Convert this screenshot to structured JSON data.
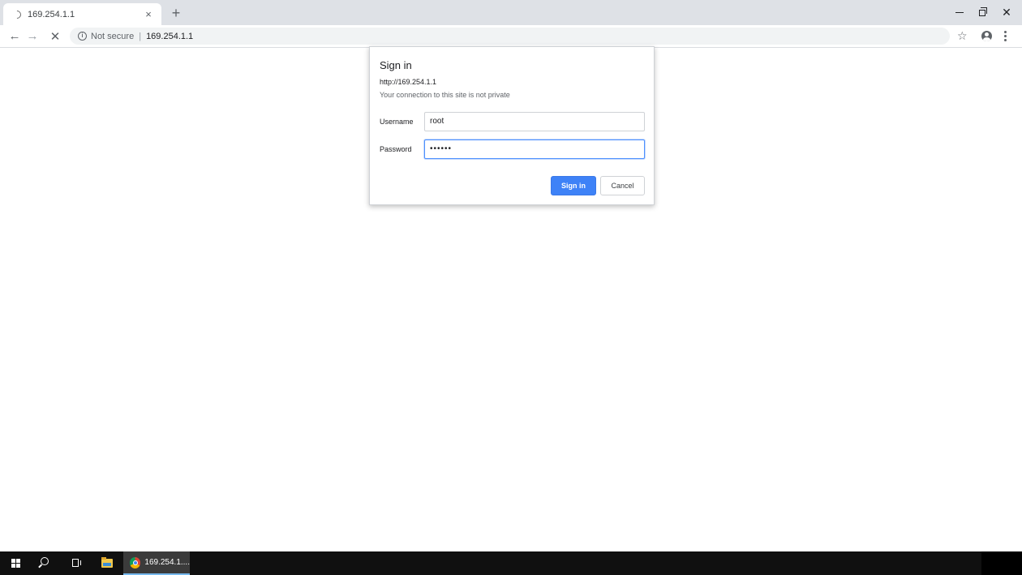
{
  "browser": {
    "tab": {
      "title": "169.254.1.1",
      "close_glyph": "×"
    },
    "new_tab_glyph": "+",
    "window_controls": {
      "close_glyph": "✕"
    },
    "nav": {
      "back_glyph": "←",
      "forward_glyph": "→",
      "stop_glyph": "✕"
    },
    "omnibox": {
      "security_label": "Not secure",
      "separator": "|",
      "url": "169.254.1.1",
      "info_glyph": "i"
    },
    "bookmark_glyph": "☆"
  },
  "dialog": {
    "title": "Sign in",
    "origin": "http://169.254.1.1",
    "warning": "Your connection to this site is not private",
    "username_label": "Username",
    "username_value": "root",
    "password_label": "Password",
    "password_value": "••••••",
    "signin_label": "Sign in",
    "cancel_label": "Cancel",
    "accent_color": "#3e82f7"
  },
  "taskbar": {
    "chrome_label": "169.254.1...."
  },
  "icons": [
    "tab-loading-spinner-icon",
    "info-icon",
    "star-icon",
    "profile-icon",
    "menu-icon",
    "windows-start-icon",
    "search-icon",
    "task-view-icon",
    "file-explorer-icon",
    "chrome-icon"
  ]
}
